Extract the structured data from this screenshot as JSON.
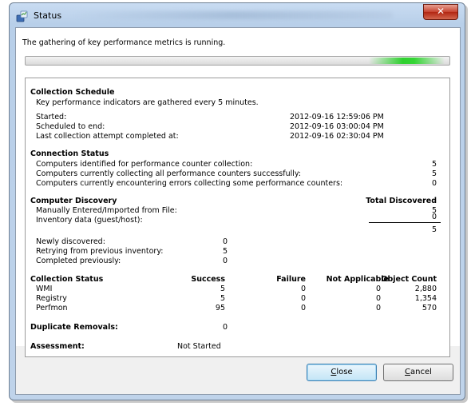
{
  "window": {
    "title": "Status",
    "close_glyph": "✕"
  },
  "intro": "The gathering of key performance metrics is running.",
  "progress": {
    "state": "indeterminate",
    "color": "#2fd02f"
  },
  "collection_schedule": {
    "heading": "Collection Schedule",
    "description": "Key performance indicators are gathered every 5 minutes.",
    "rows": [
      {
        "label": "Started:",
        "value": "2012-09-16 12:59:06 PM"
      },
      {
        "label": "Scheduled to end:",
        "value": "2012-09-16 03:00:04 PM"
      },
      {
        "label": "Last collection attempt completed at:",
        "value": "2012-09-16 02:30:04 PM"
      }
    ]
  },
  "connection_status": {
    "heading": "Connection Status",
    "rows": [
      {
        "label": "Computers identified for performance counter collection:",
        "value": "5"
      },
      {
        "label": "Computers currently collecting all performance counters successfully:",
        "value": "5"
      },
      {
        "label": "Computers currently encountering errors collecting some performance counters:",
        "value": "0"
      }
    ]
  },
  "computer_discovery": {
    "heading": "Computer Discovery",
    "total_header": "Total Discovered",
    "rows": [
      {
        "label": "Manually Entered/Imported from File:",
        "value": "5"
      },
      {
        "label": "Inventory data (guest/host):",
        "value": "0"
      }
    ],
    "total": "5",
    "status_rows": [
      {
        "label": "Newly discovered:",
        "value": "0"
      },
      {
        "label": "Retrying from previous inventory:",
        "value": "5"
      },
      {
        "label": "Completed previously:",
        "value": "0"
      }
    ]
  },
  "collection_status": {
    "heading": "Collection Status",
    "columns": [
      "Success",
      "Failure",
      "Not Applicable",
      "Object Count"
    ],
    "rows": [
      {
        "name": "WMI",
        "success": "5",
        "failure": "0",
        "not_applicable": "0",
        "object_count": "2,880"
      },
      {
        "name": "Registry",
        "success": "5",
        "failure": "0",
        "not_applicable": "0",
        "object_count": "1,354"
      },
      {
        "name": "Perfmon",
        "success": "95",
        "failure": "0",
        "not_applicable": "0",
        "object_count": "570"
      }
    ]
  },
  "duplicate_removals": {
    "label": "Duplicate Removals:",
    "value": "0"
  },
  "assessment": {
    "label": "Assessment:",
    "value": "Not Started"
  },
  "buttons": {
    "close": {
      "accel": "C",
      "rest": "lose"
    },
    "cancel": {
      "accel": "C",
      "rest": "ancel"
    }
  }
}
